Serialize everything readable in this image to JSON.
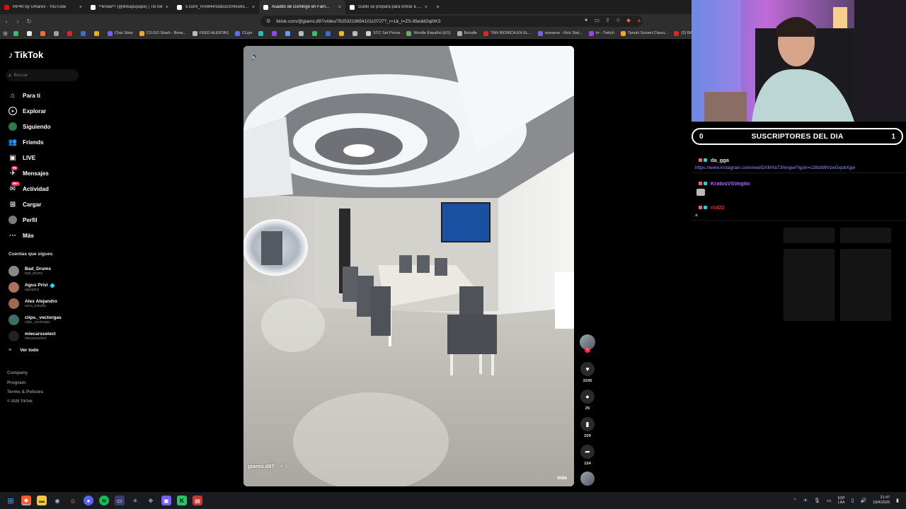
{
  "browser": {
    "tabs": [
      {
        "title": "MP40 by Umarex - YouTube",
        "color": "#ff0000",
        "active": false
      },
      {
        "title": "ᵒᵗlinwarᵉⁿ (@linkapupupe) | TikTok",
        "color": "#ffffff",
        "active": false
      },
      {
        "title": "x.com/_RAM44/status/20455659136...",
        "color": "#ffffff",
        "active": false
      },
      {
        "title": "Asadito de Domingo en Fam...",
        "color": "#ffffff",
        "active": true
      },
      {
        "title": "Guillo se prepara para entrar a la cas...",
        "color": "#ffffff",
        "active": false
      }
    ],
    "new_tab": "+",
    "url": "tiktok.com/@gianni.d97/video/7625321965410110727?_r=1&_t=ZS-95eddOqi0KS",
    "bookmarks": [
      {
        "label": "",
        "color": "#29c46b"
      },
      {
        "label": "",
        "color": "#e6e6e6"
      },
      {
        "label": "",
        "color": "#ff6a2b"
      },
      {
        "label": "",
        "color": "#9aa0a6"
      },
      {
        "label": "",
        "color": "#e02424"
      },
      {
        "label": "",
        "color": "#3d6bd9"
      },
      {
        "label": "",
        "color": "#e6b400"
      },
      {
        "label": "Chat Stats",
        "color": "#7b5cff"
      },
      {
        "label": "CS:GO Stash - Brow...",
        "color": "#f5a623"
      },
      {
        "label": "FEED ALERTAS",
        "color": "#bbbbbb"
      },
      {
        "label": "CLips",
        "color": "#5d6cf0"
      },
      {
        "label": "",
        "color": "#17c5b0"
      },
      {
        "label": "",
        "color": "#9146ff"
      },
      {
        "label": "",
        "color": "#5aa0ff"
      },
      {
        "label": "",
        "color": "#bbbbbb"
      },
      {
        "label": "",
        "color": "#29c46b"
      },
      {
        "label": "",
        "color": "#3d6bd9"
      },
      {
        "label": "",
        "color": "#f0b90b"
      },
      {
        "label": "",
        "color": "#bbbbbb"
      },
      {
        "label": "STC Set Prices",
        "color": "#d0d0d0"
      },
      {
        "label": "Wordle Español (ES)",
        "color": "#6aaa64"
      },
      {
        "label": "Boludle",
        "color": "#aaaaaa"
      },
      {
        "label": "TAN BIONICA EN EL...",
        "color": "#e02424"
      },
      {
        "label": "sionaron - Kick Stat...",
        "color": "#7b5cff"
      },
      {
        "label": "trr - Twitch",
        "color": "#9146ff"
      },
      {
        "label": "Tanuki Sunset Classi...",
        "color": "#f5a623"
      },
      {
        "label": "(2) BARRA",
        "color": "#e02424"
      }
    ]
  },
  "tiktok": {
    "logo": "TikTok",
    "search_placeholder": "Buscar",
    "nav": [
      {
        "label": "Para ti",
        "icon": "home-icon",
        "glyph": "⌂",
        "style": ""
      },
      {
        "label": "Explorar",
        "icon": "compass-icon",
        "glyph": "➤",
        "style": "circ"
      },
      {
        "label": "Siguiendo",
        "icon": "following-avatar-icon",
        "glyph": "",
        "style": "avatar"
      },
      {
        "label": "Friends",
        "icon": "friends-icon",
        "glyph": "👥",
        "style": ""
      },
      {
        "label": "LIVE",
        "icon": "live-icon",
        "glyph": "▣",
        "style": ""
      },
      {
        "label": "Mensajes",
        "icon": "messages-icon",
        "glyph": "✈",
        "style": "",
        "badge": "99"
      },
      {
        "label": "Actividad",
        "icon": "activity-icon",
        "glyph": "✉",
        "style": "",
        "badge": "99+"
      },
      {
        "label": "Cargar",
        "icon": "upload-icon",
        "glyph": "⊞",
        "style": ""
      },
      {
        "label": "Perfil",
        "icon": "profile-avatar-icon",
        "glyph": "",
        "style": "avatar2"
      },
      {
        "label": "Más",
        "icon": "more-icon",
        "glyph": "···",
        "style": ""
      }
    ],
    "following_title": "Cuentas que sigues",
    "following": [
      {
        "name": "Bad_Drums",
        "handle": "bad_drums",
        "verified": false,
        "color": "#888888"
      },
      {
        "name": "Agus Privi",
        "handle": "agusprivi",
        "verified": true,
        "color": "#b0705a"
      },
      {
        "name": "Alex Alejandro",
        "handle": "aoca_estudio",
        "verified": false,
        "color": "#a06a4a"
      },
      {
        "name": "clips._vectorgas",
        "handle": "clips._vectorgas",
        "verified": false,
        "color": "#3f6e6a"
      },
      {
        "name": "miecarsselect",
        "handle": "miecarsselect",
        "verified": false,
        "color": "#222222"
      }
    ],
    "see_all": "Ver todo",
    "footer": [
      "Company",
      "Program",
      "Terms & Policies"
    ],
    "copyright": "© 2026 TikTok",
    "video": {
      "author": "gianni.d97",
      "date": "· 4-5",
      "more": "más"
    },
    "actions": {
      "likes": "3245",
      "comments": "25",
      "saves": "209",
      "shares": "154"
    }
  },
  "stream": {
    "subs_left": "0",
    "subs_title": "SUSCRIPTORES DEL DIA",
    "subs_right": "1",
    "chat": [
      {
        "user": "da_gga",
        "user_color": "#e8e8e8",
        "text": "https://www.instagram.com/reel/DXMYaT3hmgw/?igsh=c28zbWVzeGxpbXgw",
        "link": true,
        "emote": false
      },
      {
        "user": "KratosVSVegito",
        "user_color": "#b266ff",
        "text": "",
        "link": false,
        "emote": true
      },
      {
        "user": "r0d22",
        "user_color": "#e02424",
        "text": "a",
        "link": false,
        "emote": false
      }
    ]
  },
  "taskbar": {
    "lang_top": "ESP",
    "lang_bottom": "LAA",
    "time": "21:47",
    "date": "18/4/2026"
  }
}
